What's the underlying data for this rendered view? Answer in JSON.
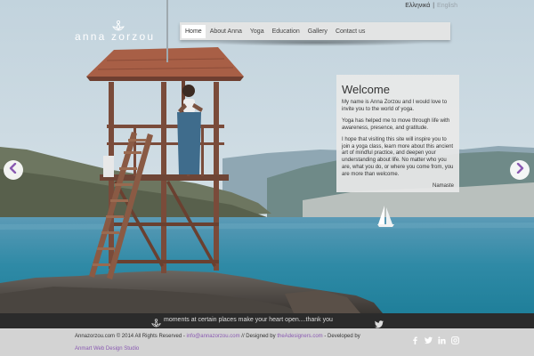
{
  "lang": {
    "greek": "Ελληνικά",
    "separator": "|",
    "english": "English"
  },
  "logo": {
    "name": "anna zorzou"
  },
  "nav": [
    {
      "label": "Home",
      "active": true
    },
    {
      "label": "About Anna"
    },
    {
      "label": "Yoga"
    },
    {
      "label": "Education"
    },
    {
      "label": "Gallery"
    },
    {
      "label": "Contact us"
    }
  ],
  "welcome": {
    "title": "Welcome",
    "p1": "My name is Anna Zorzou and I would love to invite you to the world of yoga.",
    "p2": "Yoga has helped me to move through life with awareness, presence, and gratitude.",
    "p3": "I hope that visiting this site will inspire you to join a yoga class, learn more about this ancient art of mindful practice, and deepen your understanding about life. No matter who you are, what you do, or where you come from, you are more than welcome.",
    "signoff": "Namaste"
  },
  "tagline": "moments at certain places make your heart open....thank you",
  "footer": {
    "copyright": "Annazorzou.com © 2014 All Rights Reserved - ",
    "email": "info@annazorzou.com",
    "designed_by": " // Designed by ",
    "designer": "theAdesigners.com",
    "developed_by": " - Developed by",
    "developer": "Anmart Web Design Studio"
  },
  "colors": {
    "accent": "#8a5ab2",
    "bar": "#2b2b2b",
    "footer": "#d3d3d3",
    "panel": "#e8e8e8"
  },
  "icons": [
    "lotus-icon",
    "chevron-left-icon",
    "chevron-right-icon",
    "twitter-icon",
    "facebook-icon",
    "linkedin-icon",
    "instagram-icon"
  ]
}
